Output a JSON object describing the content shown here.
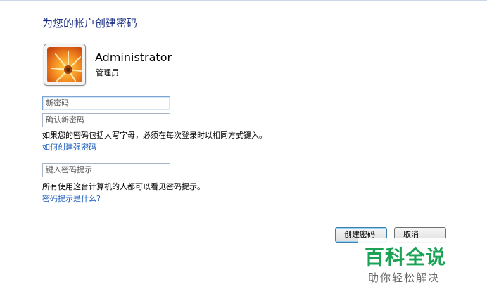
{
  "dialog": {
    "heading": "为您的帐户创建密码",
    "user": {
      "name": "Administrator",
      "role": "管理员",
      "avatar_icon": "flower-icon"
    },
    "fields": {
      "new_password_placeholder": "新密码",
      "confirm_password_placeholder": "确认新密码",
      "hint_placeholder": "键入密码提示"
    },
    "case_note": "如果您的密码包括大写字母，必须在每次登录时以相同方式键入。",
    "strong_password_link": "如何创建强密码",
    "hint_note": "所有使用这台计算机的人都可以看见密码提示。",
    "hint_link": "密码提示是什么?",
    "buttons": {
      "create_label": "创建密码",
      "cancel_label": "取消"
    }
  },
  "watermark": {
    "title": "百科全说",
    "subtitle": "助你轻松解决"
  },
  "colors": {
    "heading": "#1e3287",
    "link": "#1e5ebd",
    "watermark_green": "#1aa355"
  }
}
